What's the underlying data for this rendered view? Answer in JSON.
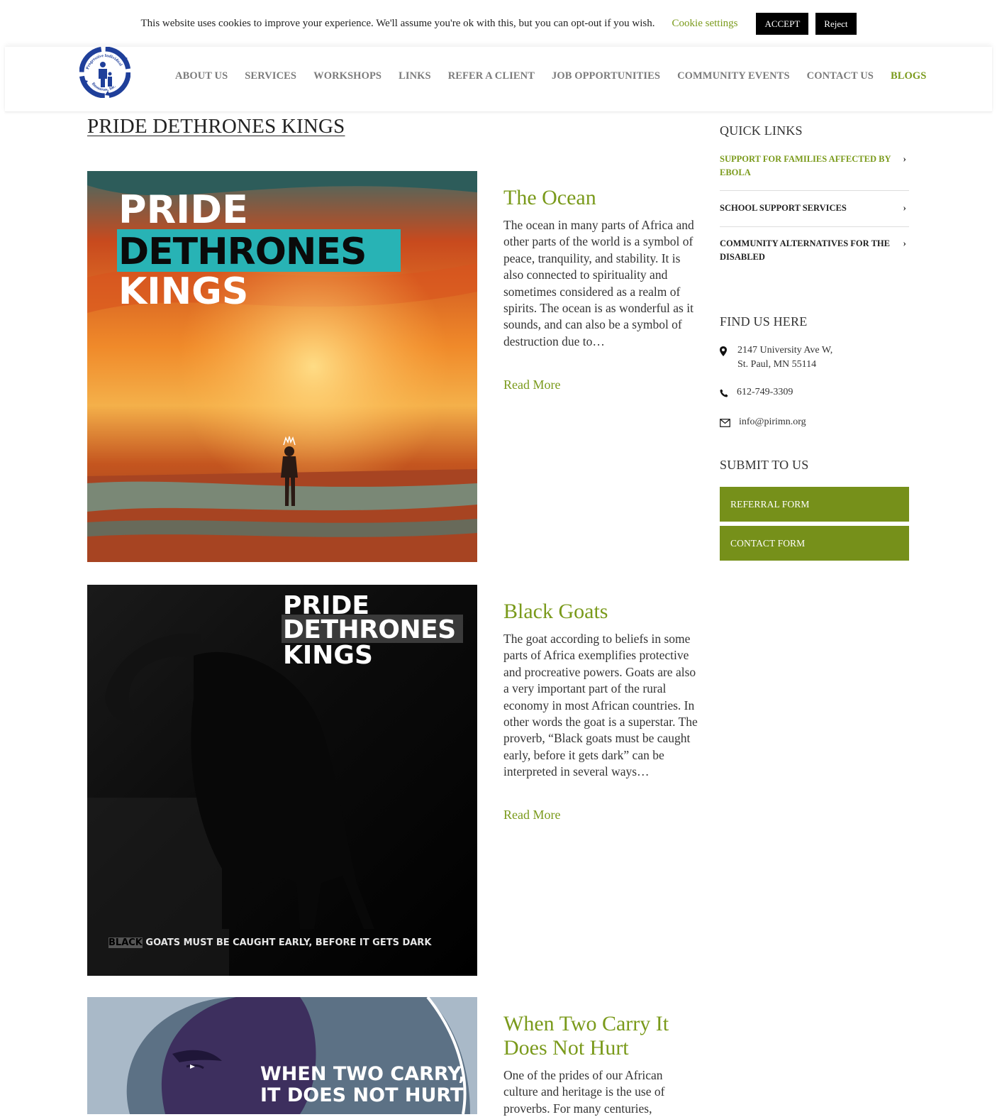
{
  "cookie": {
    "text": "This website uses cookies to improve your experience. We'll assume you're ok with this, but you can opt-out if you wish.",
    "settings_label": "Cookie settings",
    "accept_label": "ACCEPT",
    "reject_label": "Reject"
  },
  "logo": {
    "org_name_line1": "Progressive Individual",
    "org_name_line2": "Resources, Inc."
  },
  "nav": {
    "items": [
      "ABOUT US",
      "SERVICES",
      "WORKSHOPS",
      "LINKS",
      "REFER A CLIENT",
      "JOB OPPORTUNITIES",
      "COMMUNITY EVENTS",
      "CONTACT US",
      "BLOGS"
    ],
    "active": "BLOGS"
  },
  "page": {
    "title": "PRIDE DETHRONES KINGS"
  },
  "posts": [
    {
      "title": "The Ocean",
      "excerpt": "The ocean in many parts of Africa and other parts of the world is a symbol of peace, tranquility, and stability. It is also connected to spirituality and sometimes considered as a realm of spirits. The ocean is as wonderful as it sounds, and can also be a symbol of destruction due to…",
      "read_more": "Read More",
      "poster": {
        "line1": "PRIDE",
        "line2": "DETHRONES",
        "line3": "KINGS"
      }
    },
    {
      "title": "Black Goats",
      "excerpt": "The goat according to beliefs in some parts of Africa exemplifies protective and procreative powers. Goats are also a very important part of the rural economy in most African countries. In other words the goat is a superstar. The proverb, “Black goats must be caught early, before it gets dark” can be interpreted in several ways…",
      "read_more": "Read More",
      "poster": {
        "line1": "PRIDE",
        "line2": "DETHRONES",
        "line3": "KINGS",
        "caption_first": "BLACK",
        "caption_rest": " GOATS MUST BE CAUGHT EARLY, BEFORE IT GETS DARK"
      }
    },
    {
      "title": "When Two Carry It Does Not Hurt",
      "excerpt": "One of the prides of our African culture and heritage is the use of proverbs. For many centuries,",
      "poster": {
        "line1": "WHEN TWO CARRY,",
        "line2": "IT DOES NOT HURT"
      }
    }
  ],
  "sidebar": {
    "quick_links_heading": "QUICK LINKS",
    "quick_links": [
      {
        "label": "SUPPORT FOR FAMILIES AFFECTED BY EBOLA",
        "color": "#7a9a1b"
      },
      {
        "label": "SCHOOL SUPPORT SERVICES",
        "color": "#222222"
      },
      {
        "label": "COMMUNITY ALTERNATIVES FOR THE DISABLED",
        "color": "#222222"
      }
    ],
    "find_heading": "FIND US HERE",
    "address_line1": "2147 University Ave W,",
    "address_line2": "St. Paul, MN 55114",
    "phone": "612-749-3309",
    "email": "info@pirimn.org",
    "submit_heading": "SUBMIT TO US",
    "referral_label": "REFERRAL FORM",
    "contact_label": "CONTACT FORM"
  },
  "colors": {
    "accent": "#7a9a1b",
    "button_green": "#76901a",
    "dark": "#000000"
  }
}
